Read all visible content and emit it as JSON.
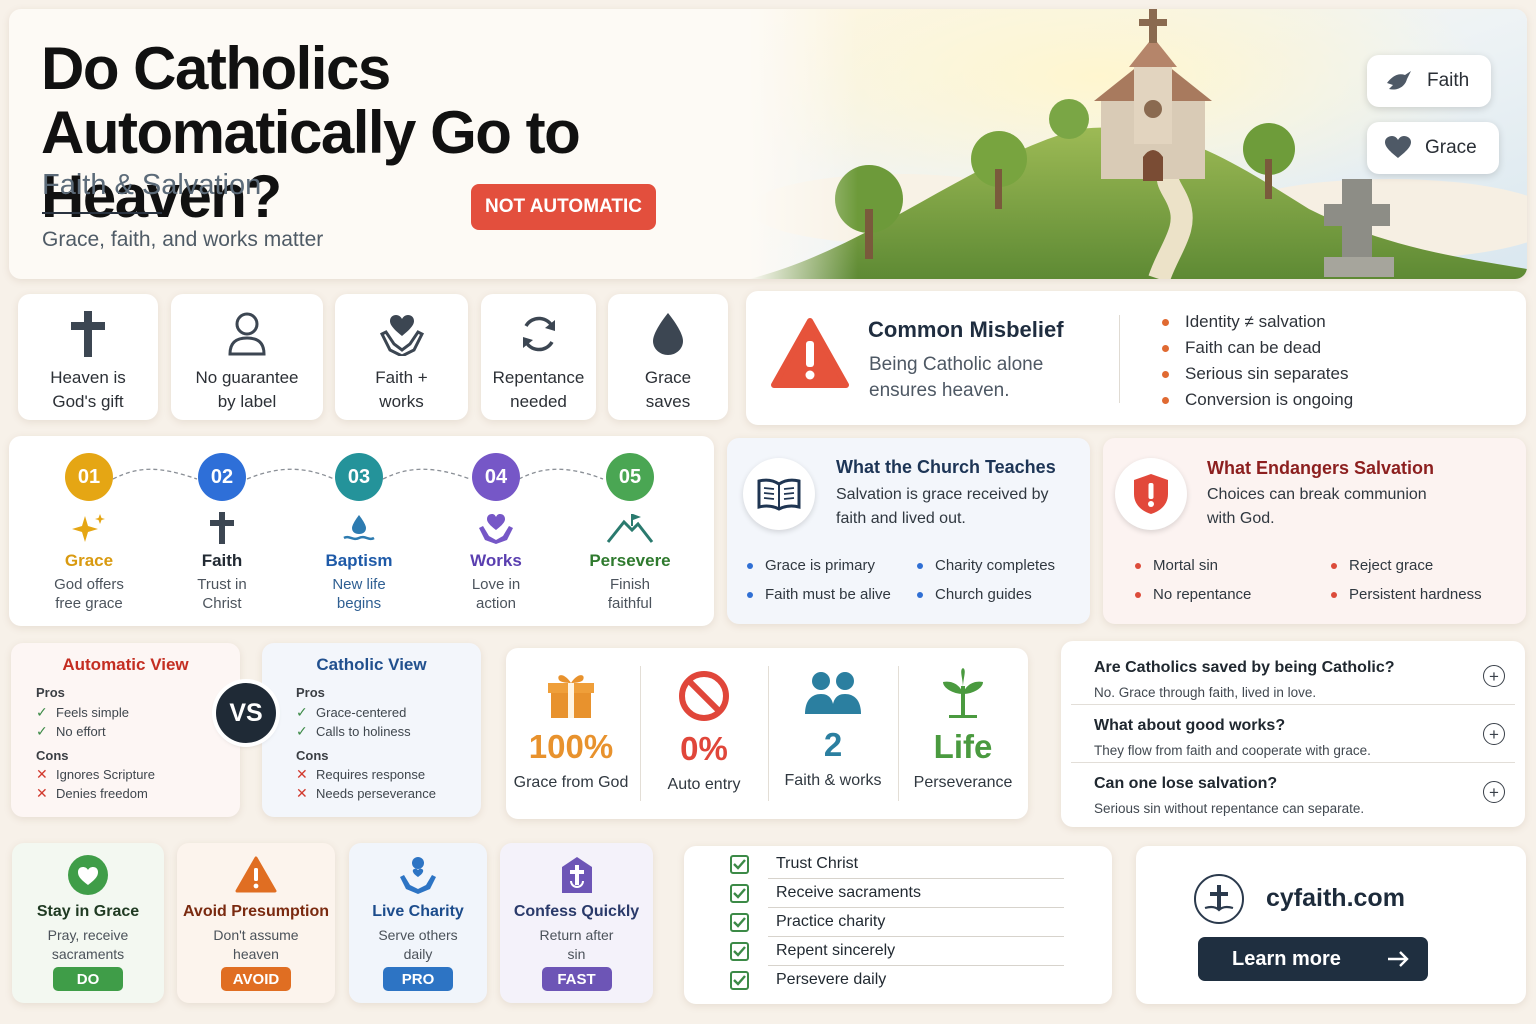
{
  "hero": {
    "title": "Do Catholics Automatically Go to Heaven?",
    "subtitle": "Faith & Salvation",
    "tagline": "Grace, faith, and works matter",
    "badge": "NOT AUTOMATIC",
    "pills": [
      {
        "label": "Faith",
        "icon": "dove-icon"
      },
      {
        "label": "Grace",
        "icon": "heart-icon"
      }
    ]
  },
  "icon_cards": [
    {
      "label": "Heaven is God's gift",
      "icon": "cross-icon"
    },
    {
      "label": "No guarantee by label",
      "icon": "person-icon"
    },
    {
      "label": "Faith + works",
      "icon": "hands-heart-icon"
    },
    {
      "label": "Repentance needed",
      "icon": "refresh-icon"
    },
    {
      "label": "Grace saves",
      "icon": "droplet-icon"
    }
  ],
  "misbelief": {
    "title": "Common Misbelief",
    "text": "Being Catholic alone ensures heaven.",
    "points": [
      "Identity ≠ salvation",
      "Faith can be dead",
      "Serious sin separates",
      "Conversion is ongoing"
    ]
  },
  "steps": [
    {
      "num": "01",
      "name": "Grace",
      "desc": "God offers free grace",
      "color": "#e5a614",
      "icon": "sparkle-icon"
    },
    {
      "num": "02",
      "name": "Faith",
      "desc": "Trust in Christ",
      "color": "#2e6fd8",
      "icon": "cross-icon"
    },
    {
      "num": "03",
      "name": "Baptism",
      "desc": "New life begins",
      "color": "#24939a",
      "icon": "water-drop-icon"
    },
    {
      "num": "04",
      "name": "Works",
      "desc": "Love in action",
      "color": "#7657c7",
      "icon": "hands-heart-icon"
    },
    {
      "num": "05",
      "name": "Persevere",
      "desc": "Finish faithful",
      "color": "#4aa653",
      "icon": "mountain-flag-icon"
    }
  ],
  "teaches": {
    "title": "What the Church Teaches",
    "text": "Salvation is grace received by faith and lived out.",
    "col1": [
      "Grace is primary",
      "Faith must be alive"
    ],
    "col2": [
      "Charity completes",
      "Church guides"
    ]
  },
  "endangers": {
    "title": "What Endangers Salvation",
    "text": "Choices can break communion with God.",
    "col1": [
      "Mortal sin",
      "No repentance"
    ],
    "col2": [
      "Reject grace",
      "Persistent hardness"
    ]
  },
  "compare": {
    "vs": "VS",
    "automatic": {
      "title": "Automatic View",
      "pros_label": "Pros",
      "pros": [
        "Feels simple",
        "No effort"
      ],
      "cons_label": "Cons",
      "cons": [
        "Ignores Scripture",
        "Denies freedom"
      ]
    },
    "catholic": {
      "title": "Catholic View",
      "pros_label": "Pros",
      "pros": [
        "Grace-centered",
        "Calls to holiness"
      ],
      "cons_label": "Cons",
      "cons": [
        "Requires response",
        "Needs perseverance"
      ]
    }
  },
  "stats": [
    {
      "value": "100%",
      "label": "Grace from God",
      "color": "#e8922d",
      "icon": "gift-icon"
    },
    {
      "value": "0%",
      "label": "Auto entry",
      "color": "#e0463a",
      "icon": "no-entry-icon"
    },
    {
      "value": "2",
      "label": "Faith & works",
      "color": "#2b7fa0",
      "icon": "people-icon"
    },
    {
      "value": "Life",
      "label": "Perseverance",
      "color": "#4a9a3f",
      "icon": "sprout-icon"
    }
  ],
  "faq": [
    {
      "q": "Are Catholics saved by being Catholic?",
      "a": "No. Grace through faith, lived in love."
    },
    {
      "q": "What about good works?",
      "a": "They flow from faith and cooperate with grace."
    },
    {
      "q": "Can one lose salvation?",
      "a": "Serious sin without repentance can separate."
    }
  ],
  "actions": [
    {
      "title": "Stay in Grace",
      "desc": "Pray, receive sacraments",
      "badge": "DO",
      "color": "#3f9d48",
      "title_color": "#1f3a22",
      "icon": "heart-circle-icon"
    },
    {
      "title": "Avoid Presumption",
      "desc": "Don't assume heaven",
      "badge": "AVOID",
      "color": "#e06e22",
      "title_color": "#7a2a10",
      "icon": "warning-icon"
    },
    {
      "title": "Live Charity",
      "desc": "Serve others daily",
      "badge": "PRO",
      "color": "#2d74c4",
      "title_color": "#1c4c8c",
      "icon": "charity-hands-icon"
    },
    {
      "title": "Confess Quickly",
      "desc": "Return after sin",
      "badge": "FAST",
      "color": "#6d55b6",
      "title_color": "#2a3a6a",
      "icon": "confession-tag-icon"
    }
  ],
  "checklist": [
    "Trust Christ",
    "Receive sacraments",
    "Practice charity",
    "Repent sincerely",
    "Persevere daily"
  ],
  "cta": {
    "site": "cyfaith.com",
    "button": "Learn more"
  }
}
